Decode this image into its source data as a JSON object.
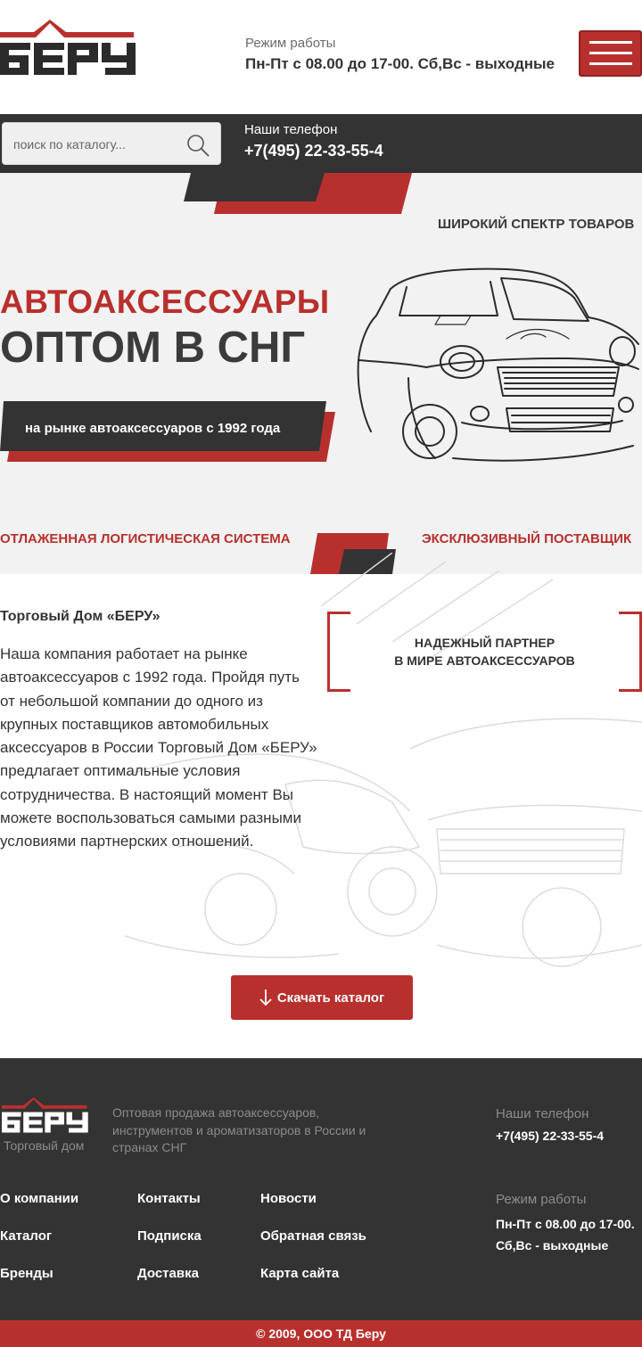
{
  "colors": {
    "accent": "#b8302d",
    "dark": "#333333",
    "hero_bg": "#f2f2f2"
  },
  "header": {
    "logo_text": "БЕРУ",
    "hours_label": "Режим работы",
    "hours_value": "Пн-Пт с 08.00 до 17-00. Сб,Вс - выходные",
    "menu_icon": "hamburger-icon"
  },
  "search": {
    "placeholder": "поиск по каталогу...",
    "icon": "search-icon"
  },
  "phone": {
    "label": "Наши телефон",
    "value": "+7(495) 22-33-55-4"
  },
  "hero": {
    "tagline_top": "ШИРОКИЙ СПЕКТР ТОВАРОВ",
    "title_line1": "АВТОАКСЕССУАРЫ",
    "title_line2": "ОПТОМ В СНГ",
    "since": "на рынке автоаксессуаров с 1992 года",
    "feature_left": "ОТЛАЖЕННАЯ ЛОГИСТИЧЕСКАЯ СИСТЕМА",
    "feature_right": "ЭКСКЛЮЗИВНЫЙ ПОСТАВЩИК"
  },
  "about": {
    "title": "Торговый Дом «БЕРУ»",
    "text": "Наша компания работает на рынке автоаксессуаров с 1992 года. Пройдя путь от небольшой компании до одного из крупных поставщиков автомобильных аксессуаров  в России Торговый Дом «БЕРУ» предлагает оптимальные условия сотрудничества. В настоящий момент Вы можете воспользоваться самыми разными  условиями партнерских отношений.",
    "partner_line1": "НАДЕЖНЫЙ ПАРТНЕР",
    "partner_line2": "В МИРЕ АВТОАКСЕССУАРОВ",
    "download_label": "Скачать каталог"
  },
  "footer": {
    "logo_sub": "Торговый дом",
    "description": "Оптовая продажа автоаксессуаров, инструментов и ароматизаторов в России и странах СНГ",
    "phone_label": "Наши телефон",
    "phone": "+7(495) 22-33-55-4",
    "hours_label": "Режим работы",
    "hours": "Пн-Пт с 08.00 до 17-00. Сб,Вс - выходные",
    "links": [
      "О компании",
      "Контакты",
      "Новости",
      "Каталог",
      "Подписка",
      "Обратная связь",
      "Бренды",
      "Доставка",
      "Карта сайта"
    ],
    "copyright": "© 2009, ООО ТД Беру"
  }
}
